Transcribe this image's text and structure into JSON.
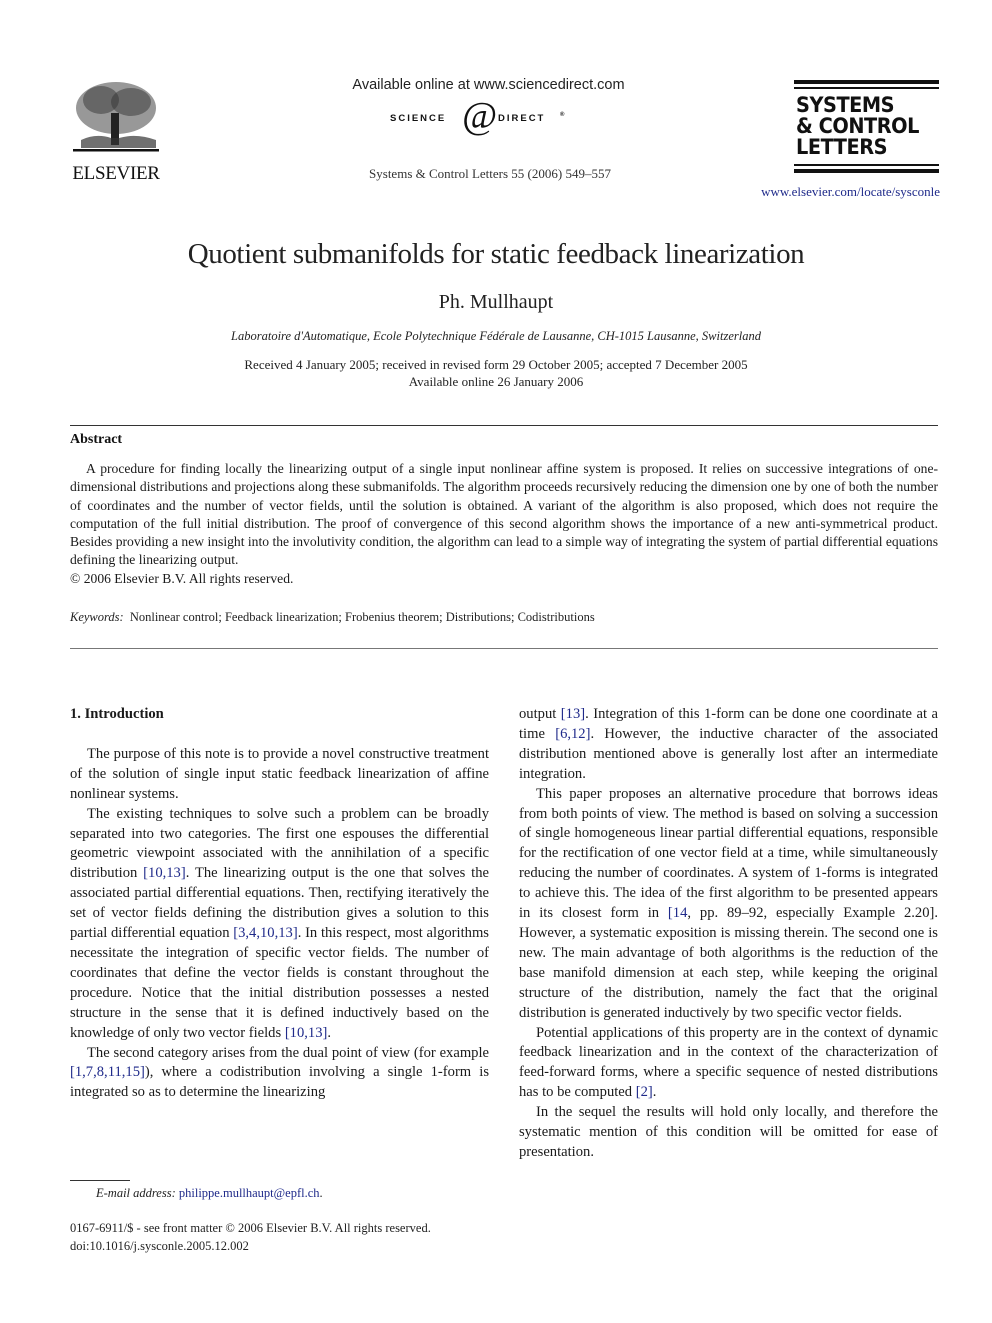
{
  "header": {
    "publisher": "ELSEVIER",
    "available_online": "Available online at www.sciencedirect.com",
    "sciencedirect_left": "SCIENCE",
    "sciencedirect_at": "d",
    "sciencedirect_right": "DIRECT",
    "sciencedirect_reg": "®",
    "journal_ref": "Systems & Control Letters 55 (2006) 549–557",
    "journal_logo_lines": [
      "SYSTEMS",
      "& CONTROL",
      "LETTERS"
    ],
    "journal_url": "www.elsevier.com/locate/sysconle"
  },
  "article": {
    "title": "Quotient submanifolds for static feedback linearization",
    "author": "Ph. Mullhaupt",
    "affiliation": "Laboratoire d'Automatique, Ecole Polytechnique Fédérale de Lausanne, CH-1015 Lausanne, Switzerland",
    "received": "Received 4 January 2005; received in revised form 29 October 2005; accepted 7 December 2005",
    "available": "Available online 26 January 2006"
  },
  "abstract": {
    "heading": "Abstract",
    "text": "A procedure for finding locally the linearizing output of a single input nonlinear affine system is proposed. It relies on successive integrations of one-dimensional distributions and projections along these submanifolds. The algorithm proceeds recursively reducing the dimension one by one of both the number of coordinates and the number of vector fields, until the solution is obtained. A variant of the algorithm is also proposed, which does not require the computation of the full initial distribution. The proof of convergence of this second algorithm shows the importance of a new anti-symmetrical product. Besides providing a new insight into the involutivity condition, the algorithm can lead to a simple way of integrating the system of partial differential equations defining the linearizing output.",
    "copyright": "© 2006 Elsevier B.V. All rights reserved."
  },
  "keywords": {
    "label": "Keywords:",
    "text": "Nonlinear control; Feedback linearization; Frobenius theorem; Distributions; Codistributions"
  },
  "intro": {
    "heading": "1.  Introduction",
    "p1": "The purpose of this note is to provide a novel constructive treatment of the solution of single input static feedback linearization of affine nonlinear systems.",
    "p2": {
      "a": "The existing techniques to solve such a problem can be broadly separated into two categories. The first one espouses the differential geometric viewpoint associated with the annihilation of a specific distribution ",
      "ref1": "[10,13]",
      "b": ". The linearizing output is the one that solves the associated partial differential equations. Then, rectifying iteratively the set of vector fields defining the distribution gives a solution to this partial differential equation ",
      "ref2": "[3,4,10,13]",
      "c": ". In this respect, most algorithms necessitate the integration of specific vector fields. The number of coordinates that define the vector fields is constant throughout the procedure. Notice that the initial distribution possesses a nested structure in the sense that it is defined inductively based on the knowledge of only two vector fields ",
      "ref3": "[10,13]",
      "d": "."
    },
    "p3": {
      "a": "The second category arises from the dual point of view (for example ",
      "ref1": "[1,7,8,11,15]",
      "b": "), where a codistribution involving a single 1-form is integrated so as to determine the linearizing output ",
      "ref2": "[13]",
      "c": ". Integration of this 1-form can be done one coordinate at a time ",
      "ref3": "[6,12]",
      "d": ". However, the inductive character of the associated distribution mentioned above is generally lost after an intermediate integration."
    },
    "p4": {
      "a": "This paper proposes an alternative procedure that borrows ideas from both points of view. The method is based on solving a succession of single homogeneous linear partial differential equations, responsible for the rectification of one vector field at a time, while simultaneously reducing the number of coordinates. A system of 1-forms is integrated to achieve this. The idea of the first algorithm to be presented appears in its closest form in ",
      "ref1": "[14",
      "b": ", pp. 89–92, especially Example 2.20]. However, a systematic exposition is missing therein. The second one is new. The main advantage of both algorithms is the reduction of the base manifold dimension at each step, while keeping the original structure of the distribution, namely the fact that the original distribution is generated inductively by two specific vector fields."
    },
    "p5": {
      "a": "Potential applications of this property are in the context of dynamic feedback linearization and in the context of the characterization of feed-forward forms, where a specific sequence of nested distributions has to be computed ",
      "ref1": "[2]",
      "b": "."
    },
    "p6": "In the sequel the results will hold only locally, and therefore the systematic mention of this condition will be omitted for ease of presentation."
  },
  "footnote": {
    "label": "E-mail address:",
    "email": "philippe.mullhaupt@epfl.ch",
    "end": "."
  },
  "front_matter": {
    "line1": "0167-6911/$ - see front matter © 2006 Elsevier B.V. All rights reserved.",
    "line2": "doi:10.1016/j.sysconle.2005.12.002"
  },
  "colors": {
    "link": "#1f2a8a",
    "text": "#1a1a1a"
  }
}
